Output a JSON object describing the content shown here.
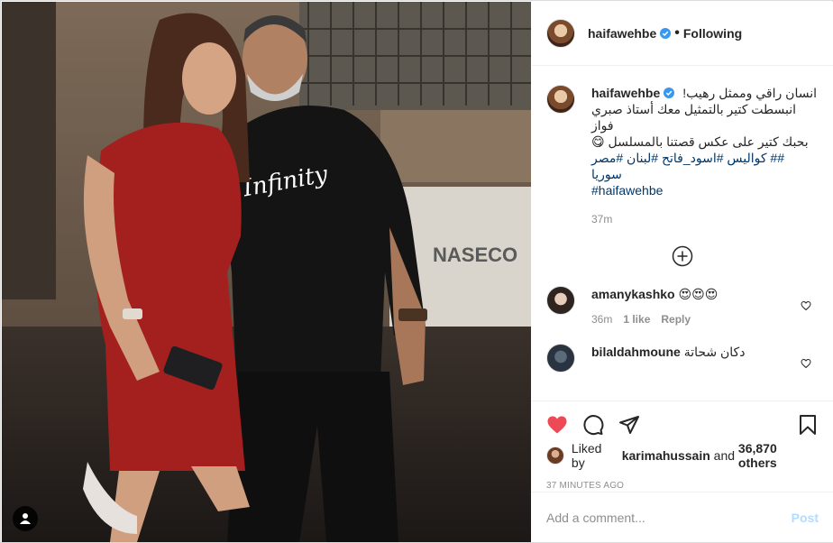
{
  "post": {
    "author": "haifawehbe",
    "follow_state": "Following",
    "separator": "•"
  },
  "caption": {
    "username": "haifawehbe",
    "lines": [
      "انسان راقي وممثل رهيب!",
      "انبسطت كتير بالتمثيل معك أستاذ صبري فواز",
      "بحبك كتير على عكس قصتنا بالمسلسل 😋",
      "## كواليس #اسود_فاتح #لبنان #مصر سوريا",
      "#haifawehbe"
    ],
    "time": "37m"
  },
  "comments": [
    {
      "username": "amanykashko",
      "text": "😍😍😍",
      "time": "36m",
      "likes": "1 like",
      "reply": "Reply"
    },
    {
      "username": "bilaldahmoune",
      "text": "دكان شحاتة"
    }
  ],
  "likes": {
    "prefix": "Liked by",
    "user": "karimahussain",
    "and": "and",
    "others": "36,870 others"
  },
  "post_time": "37 MINUTES AGO",
  "add_comment": {
    "placeholder": "Add a comment...",
    "post_label": "Post"
  },
  "photo": {
    "shirt_text": "Infinity",
    "sign_text": "NASECO"
  },
  "colors": {
    "like_red": "#ed4956",
    "verified_blue": "#3897f0",
    "hashtag": "#00376b",
    "muted": "#8e8e8e",
    "post_disabled": "#b3dbff"
  },
  "icons": {
    "like": "heart-filled-icon",
    "comment": "comment-bubble-icon",
    "share": "paper-plane-icon",
    "save": "bookmark-icon",
    "load_more": "plus-circle-icon",
    "user_tags": "user-icon"
  }
}
